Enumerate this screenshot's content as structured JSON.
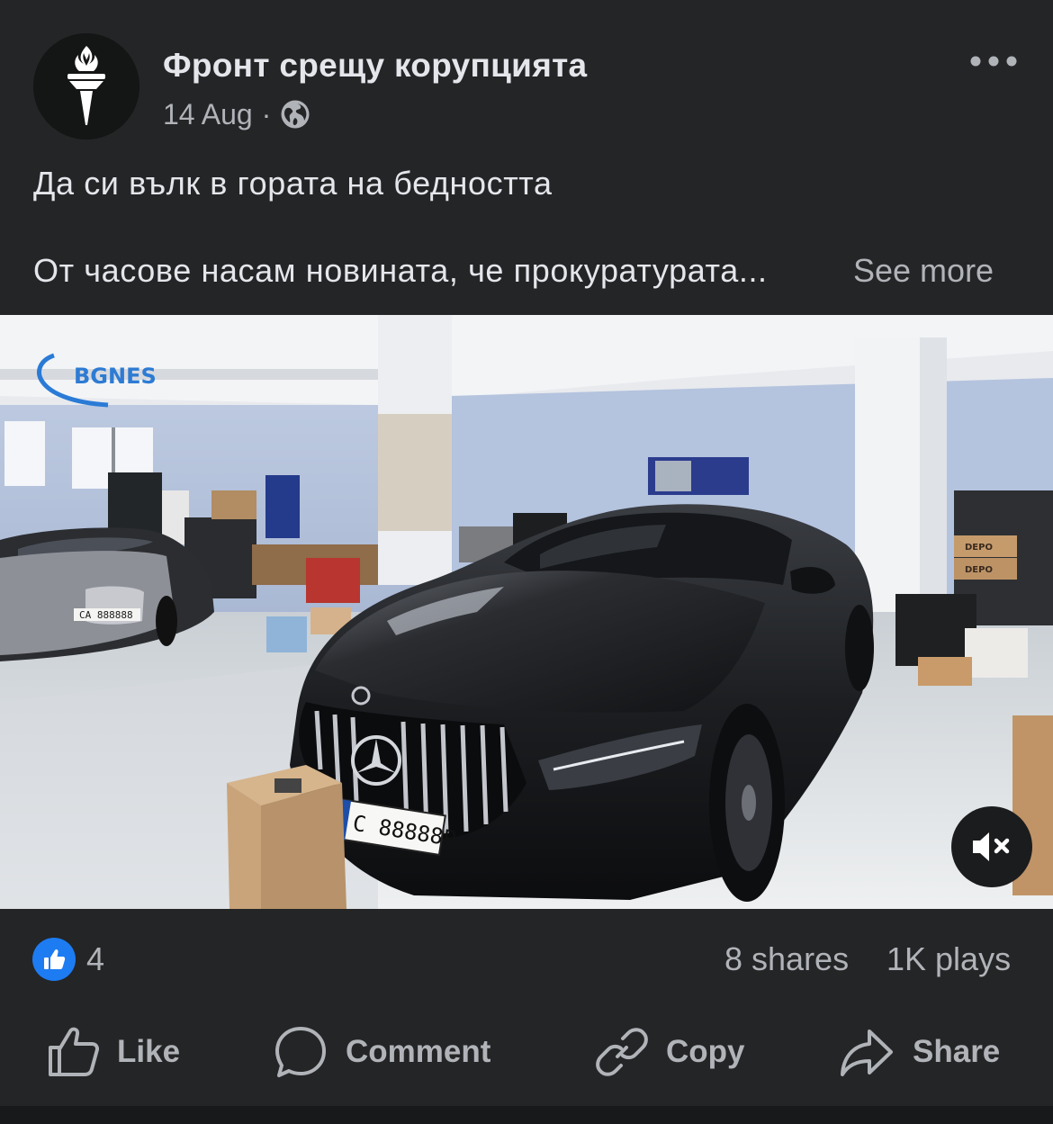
{
  "post": {
    "page_name": "Фронт срещу корупцията",
    "date": "14 Aug",
    "separator": "·",
    "privacy_icon": "globe-icon",
    "more_icon": "more-dots-icon",
    "text_line1": "Да си вълк в гората на бедността",
    "text_line2": "От часове насам новината, че прокуратурата...",
    "see_more": "See more"
  },
  "media": {
    "watermark": "BGNES",
    "plate_front": "С 88888Р",
    "plate_side": "СА 888888",
    "box_label": "DEPO",
    "mute_icon": "muted-speaker-icon"
  },
  "stats": {
    "reaction_icon": "like-reaction-icon",
    "reaction_count": "4",
    "shares": "8 shares",
    "plays": "1K plays"
  },
  "actions": {
    "like": "Like",
    "comment": "Comment",
    "copy": "Copy",
    "share": "Share"
  },
  "colors": {
    "background": "#242526",
    "text": "#e4e6eb",
    "secondary_text": "#b0b3b8",
    "like_blue": "#1d7cf2"
  }
}
